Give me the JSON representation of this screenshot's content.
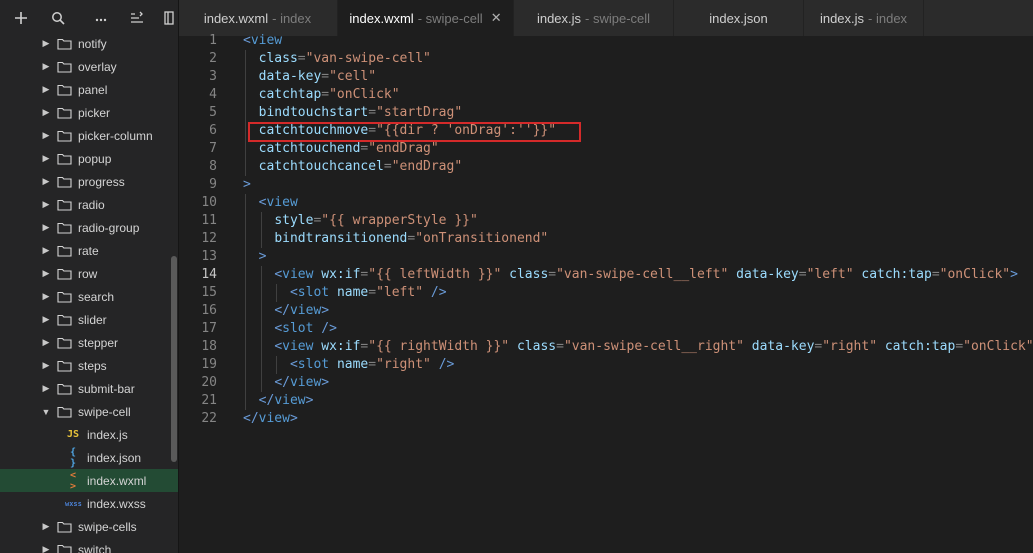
{
  "toolbar": {
    "add_icon": "plus-icon",
    "search_icon": "search-icon",
    "more_icon": "ellipsis-icon",
    "outline_icon": "sort-icon",
    "layout_icon": "layout-icon"
  },
  "tabs": [
    {
      "name": "index.wxml",
      "sub": "- index",
      "active": false
    },
    {
      "name": "index.wxml",
      "sub": "- swipe-cell",
      "active": true
    },
    {
      "name": "index.js",
      "sub": "- swipe-cell",
      "active": false
    },
    {
      "name": "index.json",
      "sub": "",
      "active": false
    },
    {
      "name": "index.js",
      "sub": "- index",
      "active": false
    }
  ],
  "tab_close": "✕",
  "tree": [
    {
      "label": "notify",
      "type": "folder",
      "expanded": false
    },
    {
      "label": "overlay",
      "type": "folder",
      "expanded": false
    },
    {
      "label": "panel",
      "type": "folder",
      "expanded": false
    },
    {
      "label": "picker",
      "type": "folder",
      "expanded": false
    },
    {
      "label": "picker-column",
      "type": "folder",
      "expanded": false
    },
    {
      "label": "popup",
      "type": "folder",
      "expanded": false
    },
    {
      "label": "progress",
      "type": "folder",
      "expanded": false
    },
    {
      "label": "radio",
      "type": "folder",
      "expanded": false
    },
    {
      "label": "radio-group",
      "type": "folder",
      "expanded": false
    },
    {
      "label": "rate",
      "type": "folder",
      "expanded": false
    },
    {
      "label": "row",
      "type": "folder",
      "expanded": false
    },
    {
      "label": "search",
      "type": "folder",
      "expanded": false
    },
    {
      "label": "slider",
      "type": "folder",
      "expanded": false
    },
    {
      "label": "stepper",
      "type": "folder",
      "expanded": false
    },
    {
      "label": "steps",
      "type": "folder",
      "expanded": false
    },
    {
      "label": "submit-bar",
      "type": "folder",
      "expanded": false
    },
    {
      "label": "swipe-cell",
      "type": "folder",
      "expanded": true
    },
    {
      "label": "index.js",
      "type": "js",
      "badge": "JS",
      "color": "#e8c33a"
    },
    {
      "label": "index.json",
      "type": "json",
      "badge": "{ }",
      "color": "#4fa3e0"
    },
    {
      "label": "index.wxml",
      "type": "wxml",
      "badge": "< >",
      "color": "#e07a3a",
      "selected": true
    },
    {
      "label": "index.wxss",
      "type": "wxss",
      "badge": "wxss",
      "color": "#4a7fd0"
    },
    {
      "label": "swipe-cells",
      "type": "folder",
      "expanded": false
    },
    {
      "label": "switch",
      "type": "folder",
      "expanded": false
    }
  ],
  "current_line": 14,
  "code_lines": [
    {
      "n": "1",
      "indent": 0,
      "parts": [
        [
          "t",
          "<"
        ],
        [
          "tn",
          "view"
        ]
      ]
    },
    {
      "n": "2",
      "indent": 1,
      "parts": [
        [
          "a",
          "class"
        ],
        [
          "p",
          "="
        ],
        [
          "s",
          "\"van-swipe-cell\""
        ]
      ]
    },
    {
      "n": "3",
      "indent": 1,
      "parts": [
        [
          "a",
          "data-key"
        ],
        [
          "p",
          "="
        ],
        [
          "s",
          "\"cell\""
        ]
      ]
    },
    {
      "n": "4",
      "indent": 1,
      "parts": [
        [
          "a",
          "catchtap"
        ],
        [
          "p",
          "="
        ],
        [
          "s",
          "\"onClick\""
        ]
      ]
    },
    {
      "n": "5",
      "indent": 1,
      "parts": [
        [
          "a",
          "bindtouchstart"
        ],
        [
          "p",
          "="
        ],
        [
          "s",
          "\"startDrag\""
        ]
      ]
    },
    {
      "n": "6",
      "indent": 1,
      "parts": [
        [
          "a",
          "catchtouchmove"
        ],
        [
          "p",
          "="
        ],
        [
          "s",
          "\"{{dir ? 'onDrag':''}}\""
        ]
      ]
    },
    {
      "n": "7",
      "indent": 1,
      "parts": [
        [
          "a",
          "catchtouchend"
        ],
        [
          "p",
          "="
        ],
        [
          "s",
          "\"endDrag\""
        ]
      ]
    },
    {
      "n": "8",
      "indent": 1,
      "parts": [
        [
          "a",
          "catchtouchcancel"
        ],
        [
          "p",
          "="
        ],
        [
          "s",
          "\"endDrag\""
        ]
      ]
    },
    {
      "n": "9",
      "indent": 0,
      "parts": [
        [
          "t",
          ">"
        ]
      ]
    },
    {
      "n": "10",
      "indent": 1,
      "parts": [
        [
          "t",
          "<"
        ],
        [
          "tn",
          "view"
        ]
      ]
    },
    {
      "n": "11",
      "indent": 2,
      "parts": [
        [
          "a",
          "style"
        ],
        [
          "p",
          "="
        ],
        [
          "s",
          "\"{{ wrapperStyle }}\""
        ]
      ]
    },
    {
      "n": "12",
      "indent": 2,
      "parts": [
        [
          "a",
          "bindtransitionend"
        ],
        [
          "p",
          "="
        ],
        [
          "s",
          "\"onTransitionend\""
        ]
      ]
    },
    {
      "n": "13",
      "indent": 1,
      "parts": [
        [
          "t",
          ">"
        ]
      ]
    },
    {
      "n": "14",
      "indent": 2,
      "parts": [
        [
          "t",
          "<"
        ],
        [
          "tn",
          "view "
        ],
        [
          "a",
          "wx:if"
        ],
        [
          "p",
          "="
        ],
        [
          "s",
          "\"{{ leftWidth }}\""
        ],
        [
          "p",
          " "
        ],
        [
          "a",
          "class"
        ],
        [
          "p",
          "="
        ],
        [
          "s",
          "\"van-swipe-cell__left\""
        ],
        [
          "p",
          " "
        ],
        [
          "a",
          "data-key"
        ],
        [
          "p",
          "="
        ],
        [
          "s",
          "\"left\""
        ],
        [
          "p",
          " "
        ],
        [
          "a",
          "catch:tap"
        ],
        [
          "p",
          "="
        ],
        [
          "s",
          "\"onClick\""
        ],
        [
          "t",
          ">"
        ]
      ]
    },
    {
      "n": "15",
      "indent": 3,
      "parts": [
        [
          "t",
          "<"
        ],
        [
          "tn",
          "slot "
        ],
        [
          "a",
          "name"
        ],
        [
          "p",
          "="
        ],
        [
          "s",
          "\"left\""
        ],
        [
          "p",
          " "
        ],
        [
          "t",
          "/>"
        ]
      ]
    },
    {
      "n": "16",
      "indent": 2,
      "parts": [
        [
          "t",
          "</"
        ],
        [
          "tn",
          "view"
        ],
        [
          "t",
          ">"
        ]
      ]
    },
    {
      "n": "17",
      "indent": 2,
      "parts": [
        [
          "t",
          "<"
        ],
        [
          "tn",
          "slot "
        ],
        [
          "t",
          "/>"
        ]
      ]
    },
    {
      "n": "18",
      "indent": 2,
      "parts": [
        [
          "t",
          "<"
        ],
        [
          "tn",
          "view "
        ],
        [
          "a",
          "wx:if"
        ],
        [
          "p",
          "="
        ],
        [
          "s",
          "\"{{ rightWidth }}\""
        ],
        [
          "p",
          " "
        ],
        [
          "a",
          "class"
        ],
        [
          "p",
          "="
        ],
        [
          "s",
          "\"van-swipe-cell__right\""
        ],
        [
          "p",
          " "
        ],
        [
          "a",
          "data-key"
        ],
        [
          "p",
          "="
        ],
        [
          "s",
          "\"right\""
        ],
        [
          "p",
          " "
        ],
        [
          "a",
          "catch:tap"
        ],
        [
          "p",
          "="
        ],
        [
          "s",
          "\"onClick\""
        ],
        [
          "t",
          ">"
        ]
      ]
    },
    {
      "n": "19",
      "indent": 3,
      "parts": [
        [
          "t",
          "<"
        ],
        [
          "tn",
          "slot "
        ],
        [
          "a",
          "name"
        ],
        [
          "p",
          "="
        ],
        [
          "s",
          "\"right\""
        ],
        [
          "p",
          " "
        ],
        [
          "t",
          "/>"
        ]
      ]
    },
    {
      "n": "20",
      "indent": 2,
      "parts": [
        [
          "t",
          "</"
        ],
        [
          "tn",
          "view"
        ],
        [
          "t",
          ">"
        ]
      ]
    },
    {
      "n": "21",
      "indent": 1,
      "parts": [
        [
          "t",
          "</"
        ],
        [
          "tn",
          "view"
        ],
        [
          "t",
          ">"
        ]
      ]
    },
    {
      "n": "22",
      "indent": 0,
      "parts": [
        [
          "t",
          "</"
        ],
        [
          "tn",
          "view"
        ],
        [
          "t",
          ">"
        ]
      ]
    }
  ]
}
